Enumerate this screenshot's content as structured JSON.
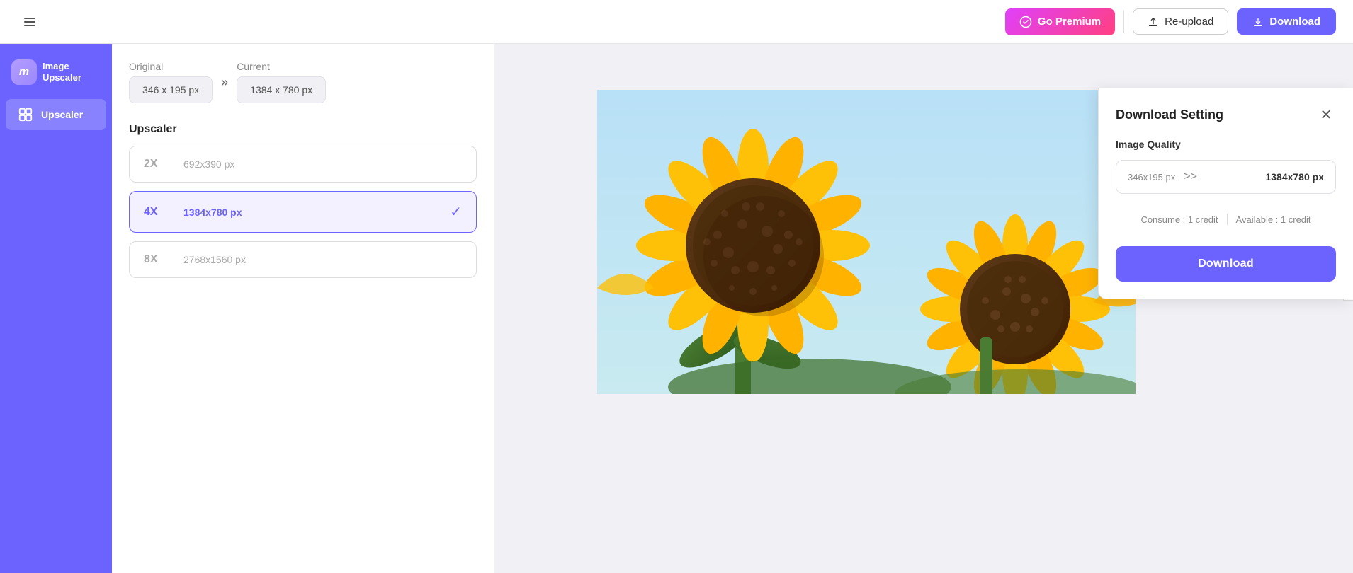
{
  "app": {
    "logo_letter": "m",
    "name_line1": "Image",
    "name_line2": "Upscaler"
  },
  "header": {
    "premium_label": "Go Premium",
    "reupload_label": "Re-upload",
    "download_label": "Download"
  },
  "sidebar": {
    "items": [
      {
        "id": "upscaler",
        "label": "Upscaler",
        "active": true
      }
    ]
  },
  "panel": {
    "original_label": "Original",
    "current_label": "Current",
    "original_dims": "346 x 195 px",
    "current_dims": "1384 x 780 px",
    "upscaler_title": "Upscaler",
    "options": [
      {
        "multiplier": "2X",
        "dims": "692x390 px",
        "selected": false
      },
      {
        "multiplier": "4X",
        "dims": "1384x780 px",
        "selected": true
      },
      {
        "multiplier": "8X",
        "dims": "2768x1560 px",
        "selected": false
      }
    ]
  },
  "download_setting": {
    "title": "Download Setting",
    "image_quality_label": "Image Quality",
    "from_dims": "346x195 px",
    "arrow": ">>",
    "to_dims": "1384x780 px",
    "consume_label": "Consume : 1 credit",
    "available_label": "Available : 1 credit",
    "download_btn": "Download"
  }
}
